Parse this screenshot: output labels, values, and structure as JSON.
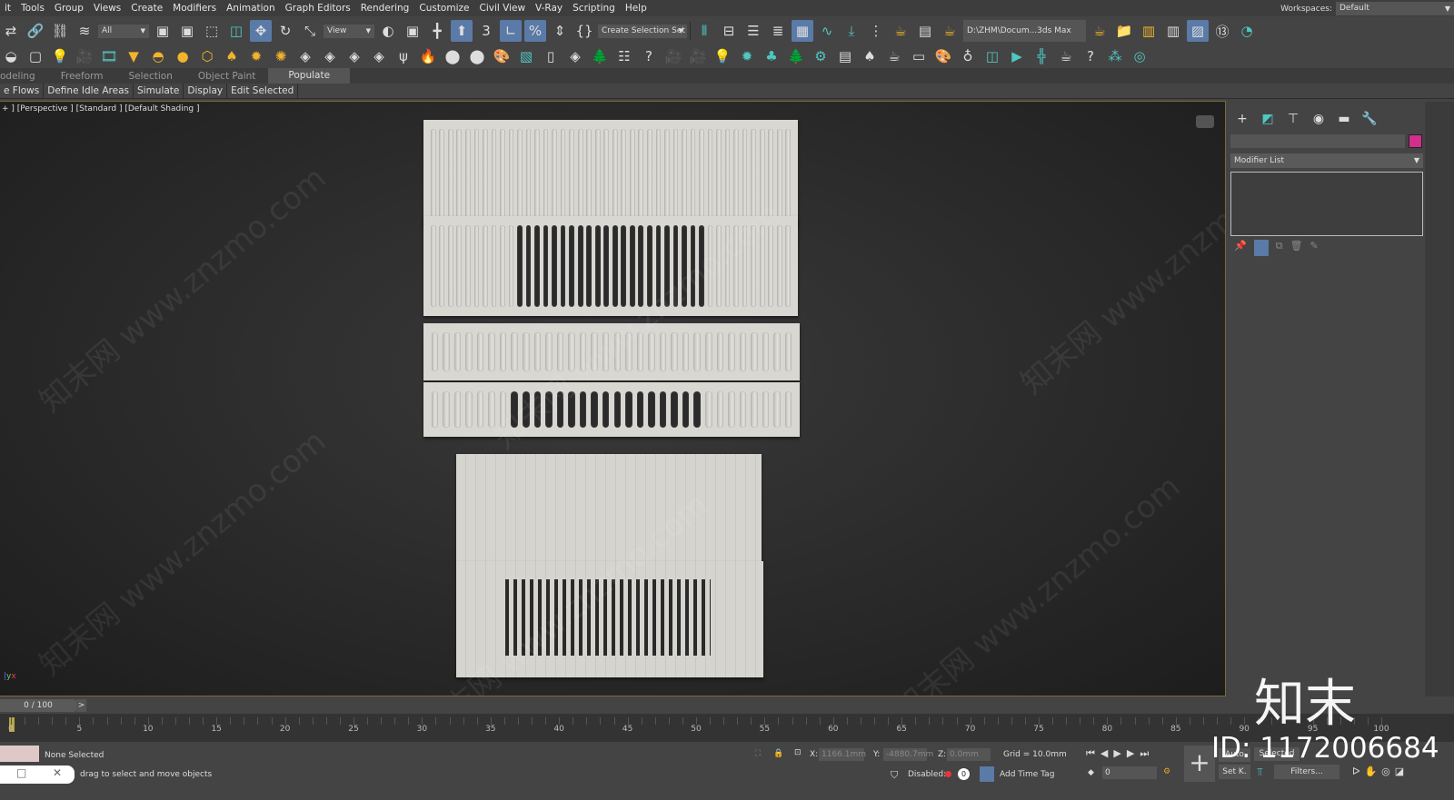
{
  "menu": [
    "it",
    "Tools",
    "Group",
    "Views",
    "Create",
    "Modifiers",
    "Animation",
    "Graph Editors",
    "Rendering",
    "Customize",
    "Civil View",
    "V-Ray",
    "Scripting",
    "Help"
  ],
  "workspaces": {
    "label": "Workspaces:",
    "value": "Default"
  },
  "toolbar1": {
    "filter": "All",
    "refcoord": "View",
    "selection_set": "Create Selection Set",
    "project_path": "D:\\ZHM\\Docum...3ds Max 202",
    "icons_a": [
      "redo-icon",
      "link-icon",
      "unlink-icon",
      "bind-spacewarp-icon"
    ],
    "icons_b": [
      "select-object-icon",
      "select-by-name-icon",
      "rect-selection-icon",
      "window-crossing-icon",
      "move-icon",
      "rotate-icon",
      "scale-icon",
      "placement-icon"
    ],
    "icons_c": [
      "select-manipulate-icon",
      "pivot-icon",
      "keyboard-shortcut-icon",
      "snap-3d-icon",
      "angle-snap-icon",
      "percent-snap-icon",
      "spinner-snap-icon",
      "named-selection-icon"
    ],
    "icons_d": [
      "mirror-icon",
      "align-icon",
      "scene-explorer-icon",
      "layer-explorer-icon",
      "ribbon-toggle-icon",
      "curve-editor-icon",
      "dope-sheet-icon",
      "schematic-view-icon",
      "render-setup-icon",
      "frame-window-icon",
      "render-icon"
    ],
    "icons_e": [
      "render-preset-icon",
      "open-folder-icon",
      "project-icon",
      "project-settings-icon",
      "autosave-icon",
      "count-13-icon",
      "history-icon"
    ]
  },
  "toolbar2_icons": [
    "hemisphere-icon",
    "box-icon",
    "light-bulb-icon",
    "camera-list-icon",
    "film-camera-icon",
    "spotlight-icon",
    "dome-light-icon",
    "sphere-light-icon",
    "geo-sphere-icon",
    "mesh-light-icon",
    "sun-icon",
    "sparkle-icon",
    "vray-box-icon",
    "vray-sphere-icon",
    "vray-fur-icon",
    "vray-proxy-icon",
    "fur-icon",
    "fire-icon",
    "material-ball-icon",
    "material-editor-icon",
    "palette-icon",
    "vfb-icon",
    "asset-icon",
    "vray-logo-icon",
    "tree-icon",
    "list-icon",
    "help-icon",
    "camera-icon",
    "camera-add-icon",
    "light-icon",
    "sun-light-icon",
    "forest-icon",
    "tree-alt-icon",
    "settings-icon",
    "doc-icon",
    "leaf-icon",
    "render-gear-icon",
    "screen-icon",
    "palette-alt-icon",
    "bulb-icon",
    "window-icon",
    "play-window-icon",
    "split-icon",
    "teapot-icon",
    "question-icon",
    "nodes-icon",
    "target-icon"
  ],
  "ribbon_tabs": [
    "odeling",
    "Freeform",
    "Selection",
    "Object Paint",
    "Populate"
  ],
  "ribbon_sub": [
    "e Flows",
    "Define Idle Areas",
    "Simulate",
    "Display",
    "Edit Selected"
  ],
  "viewport": {
    "label": "+ ] [Perspective ] [Standard ] [Default Shading ]",
    "axis_x": "x",
    "axis_y": "y"
  },
  "command_panel": {
    "modifier_list": "Modifier List",
    "object_color": "#d12f8c",
    "tabs": [
      "create-icon",
      "modify-icon",
      "hierarchy-icon",
      "motion-icon",
      "display-icon",
      "utilities-icon"
    ]
  },
  "timeline": {
    "frame": "0 / 100",
    "next": ">",
    "ticks": [
      "0",
      "5",
      "10",
      "15",
      "20",
      "25",
      "30",
      "35",
      "40",
      "45",
      "50",
      "55",
      "60",
      "65",
      "70",
      "75",
      "80",
      "85",
      "90",
      "95",
      "100"
    ]
  },
  "status": {
    "selection": "None Selected",
    "prompt": "drag to select and move objects",
    "x_label": "X:",
    "x": "1166.1mm",
    "y_label": "Y:",
    "y": "-4880.7mm",
    "z_label": "Z:",
    "z": "0.0mm",
    "grid": "Grid = 10.0mm",
    "disabled": "Disabled:",
    "zero": "0",
    "add_time_tag": "Add Time Tag",
    "frame_spinner": "0",
    "auto": "Auto",
    "selected": "Selected",
    "set_key": "Set K.",
    "filters": "Filters..."
  },
  "watermark": {
    "id": "ID: 1172006684",
    "logo": "知末",
    "site": "知末网 www.znzmo.com"
  }
}
